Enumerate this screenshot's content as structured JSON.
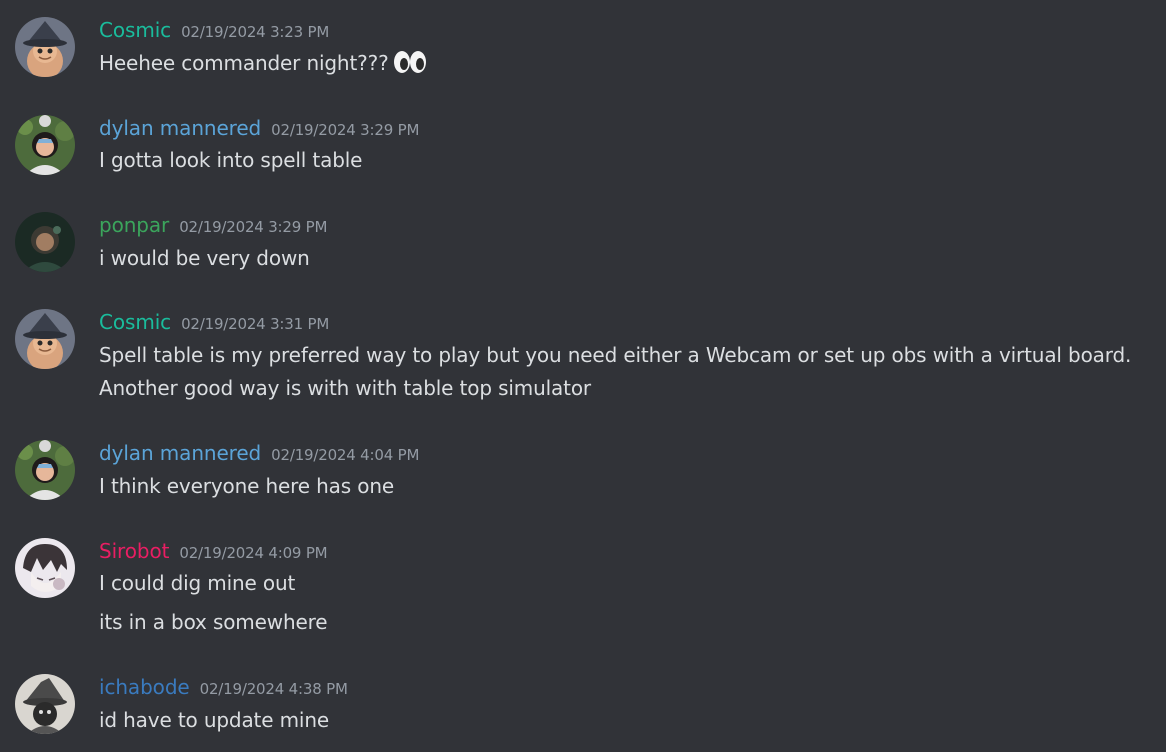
{
  "colors": {
    "background": "#313338",
    "text": "#dbdee1",
    "timestamp": "#949ba4",
    "cosmic": "#1abc9c",
    "dylan": "#5ba4d8",
    "ponpar": "#3ba55c",
    "sirobot": "#e91e63",
    "ichabode": "#3a7bbf"
  },
  "messages": [
    {
      "author": "Cosmic",
      "timestamp": "02/19/2024 3:23 PM",
      "avatar_icon": "wizard-avatar-icon",
      "lines": [
        "Heehee commander night???"
      ],
      "emoji": "eyes-emoji-icon"
    },
    {
      "author": "dylan mannered",
      "timestamp": "02/19/2024 3:29 PM",
      "avatar_icon": "person-photo-avatar-icon",
      "lines": [
        "I gotta look into spell table"
      ]
    },
    {
      "author": "ponpar",
      "timestamp": "02/19/2024 3:29 PM",
      "avatar_icon": "dark-figure-avatar-icon",
      "lines": [
        "i would be very down"
      ]
    },
    {
      "author": "Cosmic",
      "timestamp": "02/19/2024 3:31 PM",
      "avatar_icon": "wizard-avatar-icon",
      "lines": [
        "Spell table is my preferred way to play but you need either a Webcam or set up obs with a virtual board.",
        "Another good way is with with table top simulator"
      ]
    },
    {
      "author": "dylan mannered",
      "timestamp": "02/19/2024 4:04 PM",
      "avatar_icon": "person-photo-avatar-icon",
      "lines": [
        "I think everyone here has one"
      ]
    },
    {
      "author": "Sirobot",
      "timestamp": "02/19/2024 4:09 PM",
      "avatar_icon": "anime-sketch-avatar-icon",
      "lines": [
        "I could dig mine out",
        "its in a box somewhere"
      ]
    },
    {
      "author": "ichabode",
      "timestamp": "02/19/2024 4:38 PM",
      "avatar_icon": "witch-hat-avatar-icon",
      "lines": [
        "id have to update mine"
      ]
    }
  ]
}
